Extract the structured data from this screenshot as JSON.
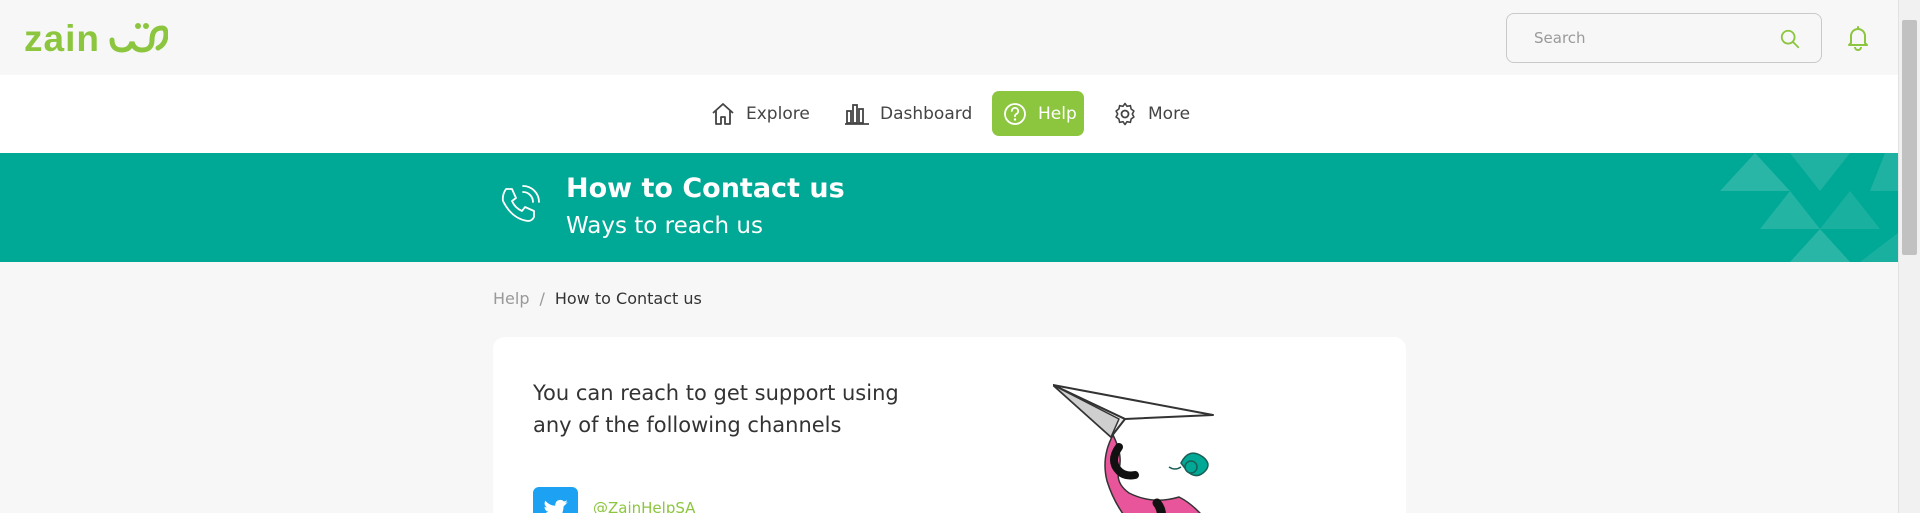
{
  "header": {
    "logo_latin": "zain",
    "search_placeholder": "Search"
  },
  "nav": {
    "items": [
      {
        "label": "Explore",
        "icon": "home-icon",
        "active": false
      },
      {
        "label": "Dashboard",
        "icon": "bar-chart-icon",
        "active": false
      },
      {
        "label": "Help",
        "icon": "question-circle-icon",
        "active": true
      },
      {
        "label": "More",
        "icon": "gear-icon",
        "active": false
      }
    ]
  },
  "banner": {
    "title": "How to Contact us",
    "subtitle": "Ways to reach us",
    "icon": "phone-icon"
  },
  "breadcrumb": {
    "parent": "Help",
    "separator": "/",
    "current": "How to Contact us"
  },
  "card": {
    "intro": "You can reach to get support using any of the following channels",
    "channels": [
      {
        "icon": "twitter-icon",
        "handle": "@ZainHelpSA"
      }
    ]
  },
  "colors": {
    "brand_green": "#8cc63f",
    "banner_teal": "#00a896",
    "twitter_blue": "#1da1f2"
  }
}
